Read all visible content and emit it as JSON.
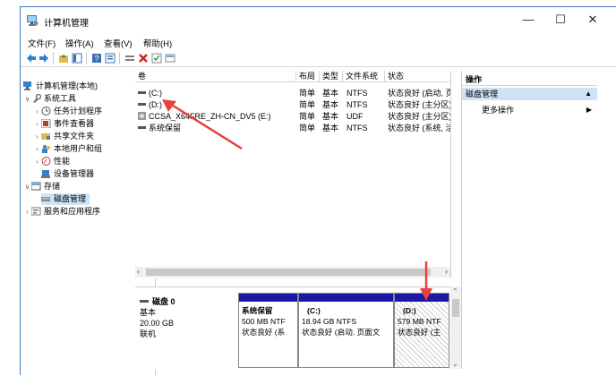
{
  "window": {
    "title": "计算机管理"
  },
  "menu": [
    "文件(F)",
    "操作(A)",
    "查看(V)",
    "帮助(H)"
  ],
  "tree": {
    "root": "计算机管理(本地)",
    "system_tools": "系统工具",
    "items": [
      "任务计划程序",
      "事件查看器",
      "共享文件夹",
      "本地用户和组",
      "性能",
      "设备管理器"
    ],
    "storage": "存储",
    "disk_mgmt": "磁盘管理",
    "services": "服务和应用程序"
  },
  "volumes": {
    "headers": [
      "卷",
      "布局",
      "类型",
      "文件系统",
      "状态"
    ],
    "rows": [
      {
        "name": "(C:)",
        "layout": "简单",
        "type": "基本",
        "fs": "NTFS",
        "status": "状态良好 (启动, 页面文"
      },
      {
        "name": "(D:)",
        "layout": "简单",
        "type": "基本",
        "fs": "NTFS",
        "status": "状态良好 (主分区)"
      },
      {
        "name": "CCSA_X64FRE_ZH-CN_DV5 (E:)",
        "layout": "简单",
        "type": "基本",
        "fs": "UDF",
        "status": "状态良好 (主分区)"
      },
      {
        "name": "系统保留",
        "layout": "简单",
        "type": "基本",
        "fs": "NTFS",
        "status": "状态良好 (系统, 活动,"
      }
    ]
  },
  "disk": {
    "name": "磁盘 0",
    "type": "基本",
    "size": "20.00 GB",
    "state": "联机",
    "partitions": [
      {
        "name": "系统保留",
        "size": "500 MB NTF",
        "status": "状态良好 (系"
      },
      {
        "name": "(C:)",
        "size": "18.94 GB NTFS",
        "status": "状态良好 (启动, 页面文"
      },
      {
        "name": "(D:)",
        "size": "579 MB NTF",
        "status": "状态良好 (主"
      }
    ]
  },
  "actions": {
    "header": "操作",
    "section": "磁盘管理",
    "more": "更多操作"
  },
  "colors": {
    "accent": "#1a1aa6",
    "selection": "#cce4f7",
    "arrow": "#e8413c"
  }
}
